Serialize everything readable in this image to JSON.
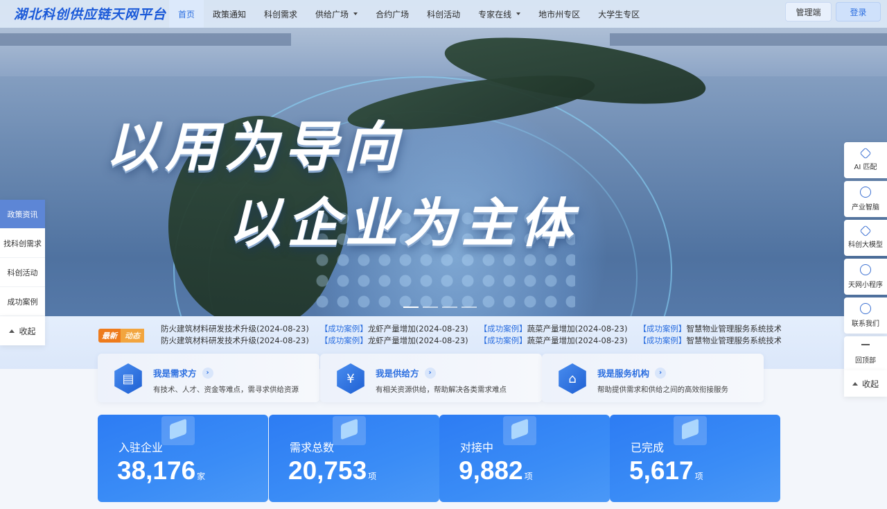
{
  "header": {
    "logo": "湖北科创供应链天网平台",
    "nav": [
      {
        "label": "首页",
        "active": true
      },
      {
        "label": "政策通知"
      },
      {
        "label": "科创需求"
      },
      {
        "label": "供给广场",
        "dropdown": true
      },
      {
        "label": "合约广场"
      },
      {
        "label": "科创活动"
      },
      {
        "label": "专家在线",
        "dropdown": true
      },
      {
        "label": "地市州专区"
      },
      {
        "label": "大学生专区"
      }
    ],
    "admin_label": "管理端",
    "login_label": "登录"
  },
  "hero": {
    "slogan_line1": "以用为导向",
    "slogan_line2": "以企业为主体"
  },
  "left_sidebar": {
    "items": [
      "政策资讯",
      "找科创需求",
      "科创活动",
      "成功案例"
    ],
    "collapse_label": "收起"
  },
  "right_sidebar": {
    "items": [
      {
        "icon": "ai-icon",
        "label": "AI 匹配"
      },
      {
        "icon": "brain-icon",
        "label": "产业智脑"
      },
      {
        "icon": "cube-icon",
        "label": "科创大模型"
      },
      {
        "icon": "mini-program-icon",
        "label": "天网小程序"
      },
      {
        "icon": "chat-icon",
        "label": "联系我们"
      },
      {
        "icon": "back-to-top-icon",
        "label": "回顶部"
      }
    ],
    "collapse_label": "收起"
  },
  "ticker": {
    "badge_a": "最新",
    "badge_b": "动态",
    "items": [
      {
        "tag": "",
        "text": "防火建筑材料研发技术升级(2024-08-23)"
      },
      {
        "tag": "【成功案例】",
        "text": "龙虾产量增加(2024-08-23)"
      },
      {
        "tag": "【成功案例】",
        "text": "蔬菜产量增加(2024-08-23)"
      },
      {
        "tag": "【成功案例】",
        "text": "智慧物业管理服务系统技术"
      }
    ]
  },
  "roles": [
    {
      "title": "我是需求方",
      "desc": "有技术、人才、资金等难点，需寻求供给资源",
      "icon": "document-icon"
    },
    {
      "title": "我是供给方",
      "desc": "有相关资源供给，帮助解决各类需求难点",
      "icon": "yuan-hand-icon"
    },
    {
      "title": "我是服务机构",
      "desc": "帮助提供需求和供给之间的高效衔接服务",
      "icon": "bank-icon"
    }
  ],
  "stats": [
    {
      "label": "入驻企业",
      "value": "38,176",
      "unit": "家"
    },
    {
      "label": "需求总数",
      "value": "20,753",
      "unit": "项"
    },
    {
      "label": "对接中",
      "value": "9,882",
      "unit": "项"
    },
    {
      "label": "已完成",
      "value": "5,617",
      "unit": "项"
    }
  ]
}
